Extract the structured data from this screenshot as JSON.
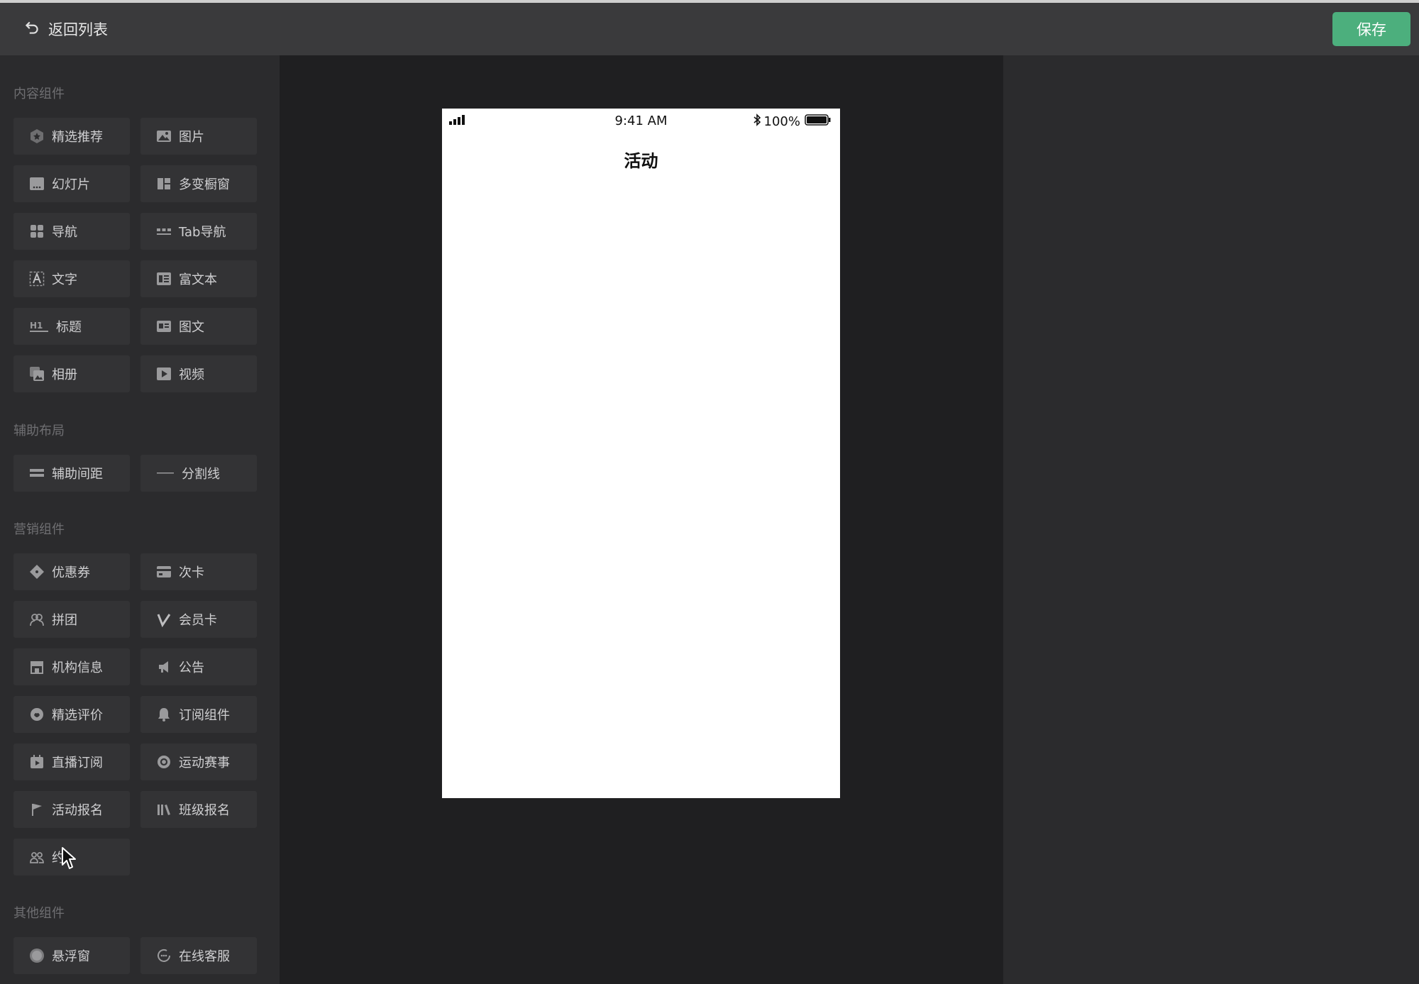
{
  "header": {
    "back_label": "返回列表",
    "save_label": "保存"
  },
  "sidebar": {
    "sections": {
      "content": "内容组件",
      "layout": "辅助布局",
      "marketing": "营销组件",
      "other": "其他组件"
    },
    "items": {
      "featured": "精选推荐",
      "image": "图片",
      "slideshow": "幻灯片",
      "showcase": "多变橱窗",
      "nav": "导航",
      "tabnav": "Tab导航",
      "text": "文字",
      "richtext": "富文本",
      "heading": "标题",
      "imagetext": "图文",
      "album": "相册",
      "video": "视频",
      "spacing": "辅助间距",
      "divider": "分割线",
      "coupon": "优惠券",
      "punchcard": "次卡",
      "groupbuy": "拼团",
      "membercard": "会员卡",
      "orginfo": "机构信息",
      "notice": "公告",
      "reviews": "精选评价",
      "subscribe": "订阅组件",
      "livesub": "直播订阅",
      "sports": "运动赛事",
      "eventsignup": "活动报名",
      "classsignup": "班级报名",
      "appointment": "约",
      "floatwin": "悬浮窗",
      "support": "在线客服"
    }
  },
  "phone": {
    "time": "9:41 AM",
    "battery": "100%",
    "title": "活动"
  },
  "colors": {
    "accent": "#4caf7d",
    "sidebar_bg": "#2b2b2d",
    "item_bg": "#333335"
  }
}
